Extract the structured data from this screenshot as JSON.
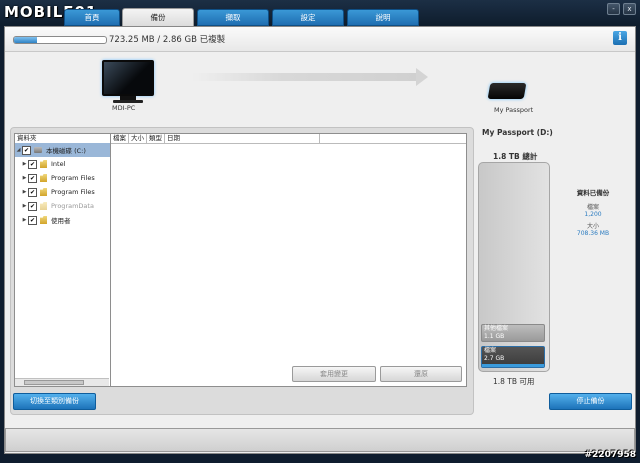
{
  "brand": {
    "logo_text": "MOBILE01"
  },
  "tabs": [
    {
      "label": "首頁"
    },
    {
      "label": "備份"
    },
    {
      "label": "擷取"
    },
    {
      "label": "設定"
    },
    {
      "label": "說明"
    }
  ],
  "window_controls": {
    "minimize": "-",
    "close": "x"
  },
  "progress": {
    "fraction": 0.25,
    "text": "723.25 MB / 2.86 GB 已複製"
  },
  "info_button": "i",
  "source_device": {
    "label": "MDI-PC"
  },
  "target_device": {
    "label": "My Passport"
  },
  "tree": {
    "header": "資料夾",
    "items": [
      {
        "label": "本機磁碟 (C:)"
      },
      {
        "label": "Intel"
      },
      {
        "label": "Program Files"
      },
      {
        "label": "Program Files"
      },
      {
        "label": "ProgramData"
      },
      {
        "label": "使用者"
      }
    ]
  },
  "file_list": {
    "columns": [
      "檔案",
      "大小",
      "類型",
      "日期"
    ]
  },
  "buttons": {
    "apply": "套用變更",
    "undo": "還原",
    "switch_mode": "切換至類別備份",
    "stop_backup": "停止備份"
  },
  "drive_panel": {
    "title": "My Passport (D:)",
    "total": "1.8 TB 總計",
    "other_label": "其他檔案",
    "other_size": "1.1 GB",
    "files_label": "檔案",
    "files_size": "2.7 GB",
    "free": "1.8 TB 可用"
  },
  "backup_summary": {
    "title": "資料已備份",
    "files_label": "檔案",
    "files_count": "1,200",
    "size_label": "大小",
    "size_value": "708.36 MB"
  },
  "watermark": "#2207958",
  "colors": {
    "accent": "#2a7bc0",
    "tab_blue": "#1f6eb1"
  }
}
